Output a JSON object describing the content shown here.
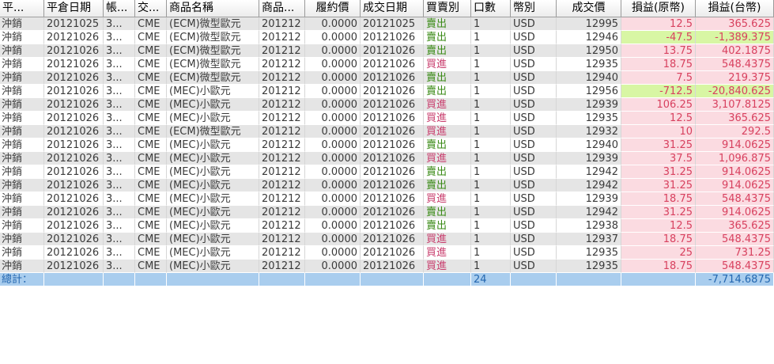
{
  "columns": [
    "平...",
    "平倉日期",
    "帳...",
    "交...",
    "商品名稱",
    "商品...",
    "履約價",
    "成交日期",
    "買賣別",
    "口數",
    "幣別",
    "成交價",
    "損益(原幣)",
    "損益(台幣)"
  ],
  "rows": [
    [
      "沖銷",
      "20121025",
      "3...",
      "CME",
      "(ECM)微型歐元",
      "201212",
      "0.0000",
      "20121025",
      "賣出",
      "1",
      "USD",
      "12995",
      "12.5",
      "365.625"
    ],
    [
      "沖銷",
      "20121026",
      "3...",
      "CME",
      "(ECM)微型歐元",
      "201212",
      "0.0000",
      "20121026",
      "賣出",
      "1",
      "USD",
      "12946",
      "-47.5",
      "-1,389.375"
    ],
    [
      "沖銷",
      "20121026",
      "3...",
      "CME",
      "(ECM)微型歐元",
      "201212",
      "0.0000",
      "20121026",
      "賣出",
      "1",
      "USD",
      "12950",
      "13.75",
      "402.1875"
    ],
    [
      "沖銷",
      "20121026",
      "3...",
      "CME",
      "(ECM)微型歐元",
      "201212",
      "0.0000",
      "20121026",
      "買進",
      "1",
      "USD",
      "12935",
      "18.75",
      "548.4375"
    ],
    [
      "沖銷",
      "20121026",
      "3...",
      "CME",
      "(ECM)微型歐元",
      "201212",
      "0.0000",
      "20121026",
      "賣出",
      "1",
      "USD",
      "12940",
      "7.5",
      "219.375"
    ],
    [
      "沖銷",
      "20121026",
      "3...",
      "CME",
      "(MEC)小歐元",
      "201212",
      "0.0000",
      "20121026",
      "賣出",
      "1",
      "USD",
      "12956",
      "-712.5",
      "-20,840.625"
    ],
    [
      "沖銷",
      "20121026",
      "3...",
      "CME",
      "(MEC)小歐元",
      "201212",
      "0.0000",
      "20121026",
      "買進",
      "1",
      "USD",
      "12939",
      "106.25",
      "3,107.8125"
    ],
    [
      "沖銷",
      "20121026",
      "3...",
      "CME",
      "(MEC)小歐元",
      "201212",
      "0.0000",
      "20121026",
      "買進",
      "1",
      "USD",
      "12935",
      "12.5",
      "365.625"
    ],
    [
      "沖銷",
      "20121026",
      "3...",
      "CME",
      "(ECM)微型歐元",
      "201212",
      "0.0000",
      "20121026",
      "買進",
      "1",
      "USD",
      "12932",
      "10",
      "292.5"
    ],
    [
      "沖銷",
      "20121026",
      "3...",
      "CME",
      "(MEC)小歐元",
      "201212",
      "0.0000",
      "20121026",
      "賣出",
      "1",
      "USD",
      "12940",
      "31.25",
      "914.0625"
    ],
    [
      "沖銷",
      "20121026",
      "3...",
      "CME",
      "(MEC)小歐元",
      "201212",
      "0.0000",
      "20121026",
      "買進",
      "1",
      "USD",
      "12939",
      "37.5",
      "1,096.875"
    ],
    [
      "沖銷",
      "20121026",
      "3...",
      "CME",
      "(MEC)小歐元",
      "201212",
      "0.0000",
      "20121026",
      "賣出",
      "1",
      "USD",
      "12942",
      "31.25",
      "914.0625"
    ],
    [
      "沖銷",
      "20121026",
      "3...",
      "CME",
      "(MEC)小歐元",
      "201212",
      "0.0000",
      "20121026",
      "賣出",
      "1",
      "USD",
      "12942",
      "31.25",
      "914.0625"
    ],
    [
      "沖銷",
      "20121026",
      "3...",
      "CME",
      "(MEC)小歐元",
      "201212",
      "0.0000",
      "20121026",
      "買進",
      "1",
      "USD",
      "12939",
      "18.75",
      "548.4375"
    ],
    [
      "沖銷",
      "20121026",
      "3...",
      "CME",
      "(MEC)小歐元",
      "201212",
      "0.0000",
      "20121026",
      "賣出",
      "1",
      "USD",
      "12942",
      "31.25",
      "914.0625"
    ],
    [
      "沖銷",
      "20121026",
      "3...",
      "CME",
      "(MEC)小歐元",
      "201212",
      "0.0000",
      "20121026",
      "賣出",
      "1",
      "USD",
      "12938",
      "12.5",
      "365.625"
    ],
    [
      "沖銷",
      "20121026",
      "3...",
      "CME",
      "(MEC)小歐元",
      "201212",
      "0.0000",
      "20121026",
      "買進",
      "1",
      "USD",
      "12937",
      "18.75",
      "548.4375"
    ],
    [
      "沖銷",
      "20121026",
      "3...",
      "CME",
      "(MEC)小歐元",
      "201212",
      "0.0000",
      "20121026",
      "買進",
      "1",
      "USD",
      "12935",
      "25",
      "731.25"
    ],
    [
      "沖銷",
      "20121026",
      "3...",
      "CME",
      "(MEC)小歐元",
      "201212",
      "0.0000",
      "20121026",
      "買進",
      "1",
      "USD",
      "12935",
      "18.75",
      "548.4375"
    ]
  ],
  "total": {
    "label": "總計：",
    "lots": "24",
    "pnl_twd": "-7,714.6875"
  },
  "colors": {
    "sell": "#3a8a16",
    "buy": "#c83c6c",
    "profit_bg": "#fbdbe1",
    "loss_bg": "#d8f6a4",
    "total_bg": "#a9cdee",
    "total_text": "#2467b0"
  }
}
